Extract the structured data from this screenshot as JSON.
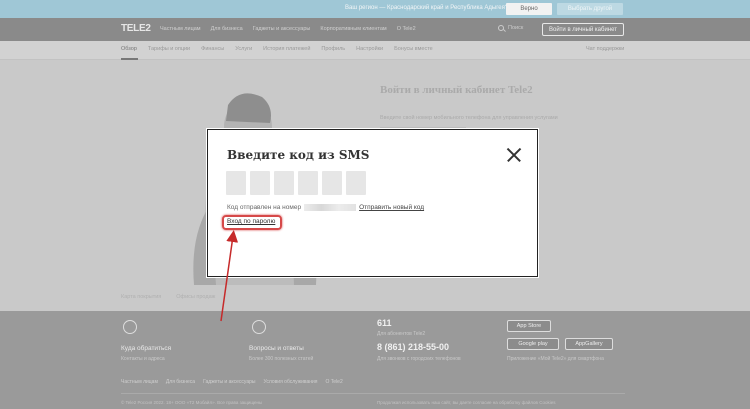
{
  "region_bar": {
    "text": "Ваш регион — Краснодарский край и Республика Адыгея?",
    "yes_label": "Верно",
    "other_label": "Выбрать другой"
  },
  "header": {
    "logo": "TELE2",
    "nav": [
      "Частным лицам",
      "Для бизнеса",
      "Гаджеты и аксессуары",
      "Корпоративным клиентам",
      "О Tele2"
    ],
    "search_label": "Поиск",
    "cabinet_label": "Войти в личный кабинет"
  },
  "subnav": {
    "items": [
      "Обзор",
      "Тарифы и опции",
      "Финансы",
      "Услуги",
      "История платежей",
      "Профиль",
      "Настройки",
      "Бонусы вместе"
    ],
    "right": "Чат поддержки"
  },
  "main": {
    "login_title": "Войти в личный кабинет Tele2",
    "login_desc": "Введите свой номер мобильного телефона для управления услугами",
    "bottom_links": [
      "Карта покрытия",
      "Офисы продаж"
    ]
  },
  "modal": {
    "title": "Введите код из SMS",
    "sent_prefix": "Код отправлен на номер",
    "resend": "Отправить новый код",
    "password_link": "Вход по паролю",
    "code_box_count": 6
  },
  "footer": {
    "col1_title": "Куда обратиться",
    "col1_sub": "Контакты и адреса",
    "col2_title": "Вопросы и ответы",
    "col2_sub": "Более 300 полезных статей",
    "short_number": "611",
    "short_sub": "Для абонентов Tele2",
    "phone": "8 (861) 218-55-00",
    "phone_sub": "Для звонков с городских телефонов",
    "app_store": "App Store",
    "google_play": "Google play",
    "app_gallery": "AppGallery",
    "app_sub": "Приложение «Мой Tele2» для смартфона",
    "links": [
      "Частным лицам",
      "Для бизнеса",
      "Гаджеты и аксессуары",
      "Условия обслуживания",
      "О Tele2"
    ],
    "copyright": "© Tele2 Россия 2022. 18+ ООО «Т2 Мобайл». Все права защищены",
    "legal": "Продолжая использовать наш сайт, вы даете согласие на обработку файлов Cookies"
  }
}
